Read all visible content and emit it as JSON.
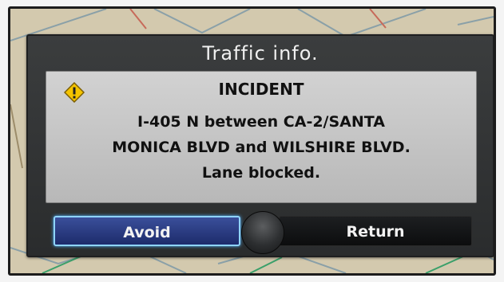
{
  "dialog": {
    "title": "Traffic info.",
    "icon": "warning-icon",
    "heading": "INCIDENT",
    "message_lines": [
      "I-405 N between CA-2/SANTA",
      "MONICA BLVD and WILSHIRE BLVD.",
      "Lane blocked."
    ]
  },
  "buttons": {
    "avoid_label": "Avoid",
    "return_label": "Return",
    "selected": "Avoid"
  },
  "colors": {
    "dialog_bg": "#2f3132",
    "message_bg": "#c6c6c6",
    "selected_button": "#2a3c85",
    "selected_border": "#8fd4ff",
    "warning_icon": "#f5c400"
  }
}
